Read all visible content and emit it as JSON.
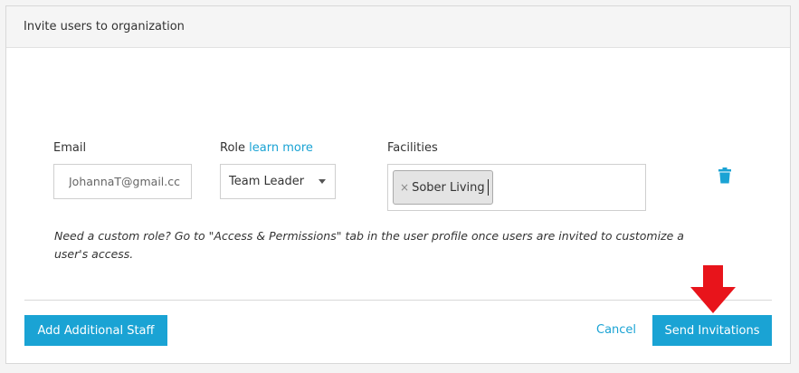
{
  "panel": {
    "title": "Invite users to organization"
  },
  "form": {
    "email_label": "Email",
    "email_value": "JohannaT@gmail.cc",
    "role_label": "Role",
    "role_link": "learn more",
    "role_value": "Team Leader",
    "facilities_label": "Facilities",
    "facility_tags": [
      "Sober Living"
    ],
    "tag_remove_glyph": "×"
  },
  "help_text": "Need a custom role? Go to \"Access & Permissions\" tab in the user profile once users are invited to customize a user's access.",
  "footer": {
    "add_staff_label": "Add Additional Staff",
    "cancel_label": "Cancel",
    "send_label": "Send Invitations"
  },
  "icons": {
    "delete": "trash-icon",
    "pointer": "arrow-down-icon"
  },
  "colors": {
    "accent": "#1aa3d4",
    "annotation": "#e8141b"
  }
}
